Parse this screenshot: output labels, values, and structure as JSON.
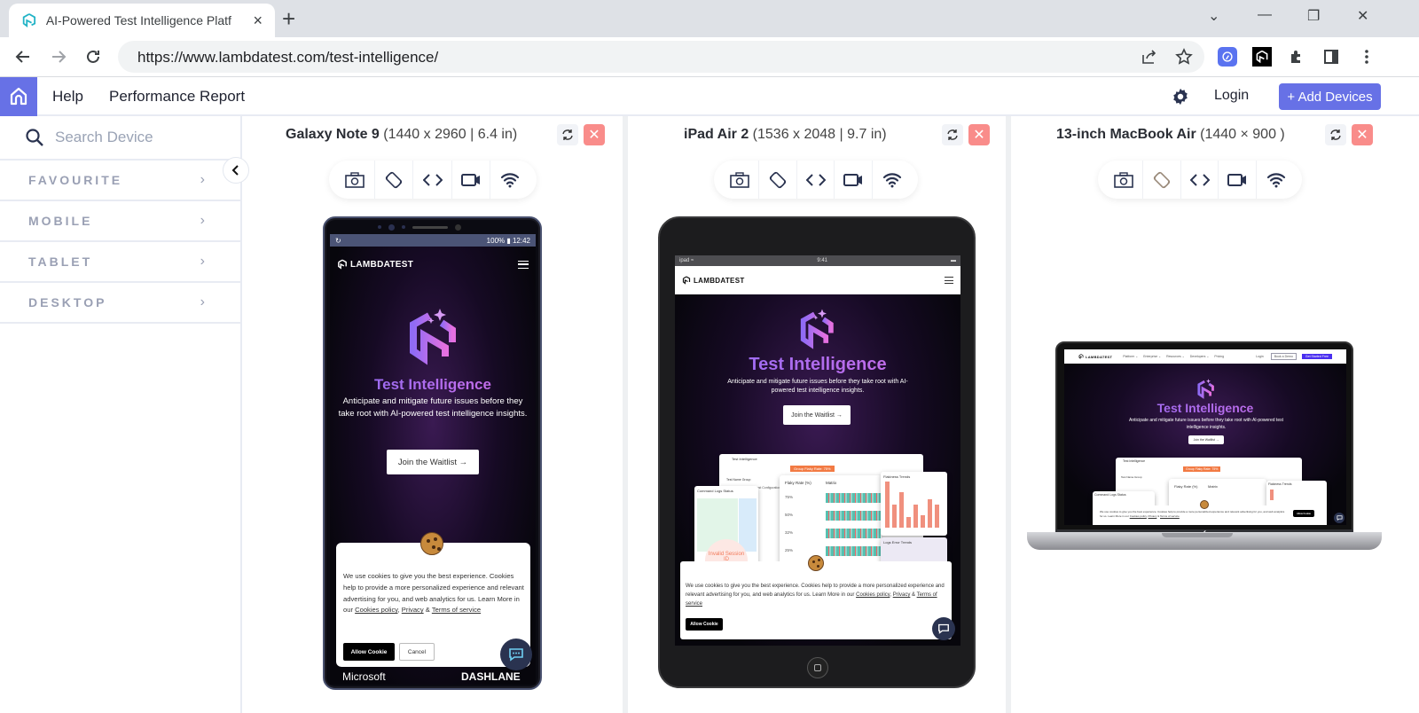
{
  "browser": {
    "tab_title": "AI-Powered Test Intelligence Platf",
    "tab_close": "×",
    "new_tab": "+",
    "url": "https://www.lambdatest.com/test-intelligence/",
    "window_controls": {
      "tab_search": "⌄",
      "minimize": "—",
      "restore": "❐",
      "close": "✕"
    },
    "icons": [
      "back-icon",
      "forward-icon",
      "reload-icon",
      "share-icon",
      "bookmark-star-icon",
      "lambdatest-extension-icon",
      "lt-extension-icon",
      "extensions-puzzle-icon",
      "side-panel-icon",
      "more-menu-icon"
    ]
  },
  "app_header": {
    "help": "Help",
    "performance_report": "Performance Report",
    "login": "Login",
    "add_devices": "+ Add Devices",
    "accent": "#6771e6"
  },
  "sidebar": {
    "search_placeholder": "Search Device",
    "categories": [
      {
        "label": "FAVOURITE"
      },
      {
        "label": "MOBILE"
      },
      {
        "label": "TABLET"
      },
      {
        "label": "DESKTOP"
      }
    ],
    "chevron": "›",
    "collapse": "‹"
  },
  "devices": [
    {
      "name": "Galaxy Note 9",
      "spec": "(1440 x 2960 | 6.4 in)",
      "status_bar": {
        "left": "↻",
        "right": "100% ▮ 12:42"
      }
    },
    {
      "name": "iPad Air 2",
      "spec": "(1536 x 2048 | 9.7 in)",
      "status_bar": {
        "left": "ipad ≈",
        "center": "9:41",
        "right": "▬"
      }
    },
    {
      "name": "13-inch MacBook Air",
      "spec": "(1440 × 900 )"
    }
  ],
  "device_tools": [
    "camera-icon",
    "rotate-icon",
    "code-icon",
    "video-icon",
    "wifi-icon"
  ],
  "site": {
    "brand": "LAMBDATEST",
    "hero_title": "Test Intelligence",
    "hero_subtitle": "Anticipate and mitigate future issues before they take root with AI-powered test intelligence insights.",
    "cta": "Join the Waitlist →",
    "cookie_text": "We use cookies to give you the best experience. Cookies help to provide a more personalized experience and relevant advertising for you, and web analytics for us. Learn More in our",
    "cookie_links": {
      "policy": "Cookies policy",
      "privacy": "Privacy",
      "amp": "&",
      "terms": "Terms of service"
    },
    "allow": "Allow Cookie",
    "cancel": "Cancel",
    "logos": {
      "left": "Microsoft",
      "right": "DASHLANE"
    },
    "mac_nav": {
      "items": [
        "Platform ⌄",
        "Enterprise ⌄",
        "Resources ⌄",
        "Developers ⌄",
        "Pricing"
      ],
      "login": "Login",
      "demo": "Book a Demo",
      "start": "Get Started Free"
    },
    "dashboard": {
      "title": "Test Intelligence",
      "badge": "Group Flaky Rate: 75%",
      "group_label": "Test Name Group",
      "filters": "Status ⌄   Duration ⌄   Test Configurations ⌄",
      "command_logs": "Command Logs Status",
      "flaky_rate": "Flaky Rate (%)",
      "matrix": "Matrix",
      "trends": "Flakiness Trends",
      "log_error": "Logs Error Trends",
      "invalid": "Invalid Session ID",
      "rates": [
        "75%",
        "50%",
        "32%",
        "25%"
      ]
    }
  }
}
